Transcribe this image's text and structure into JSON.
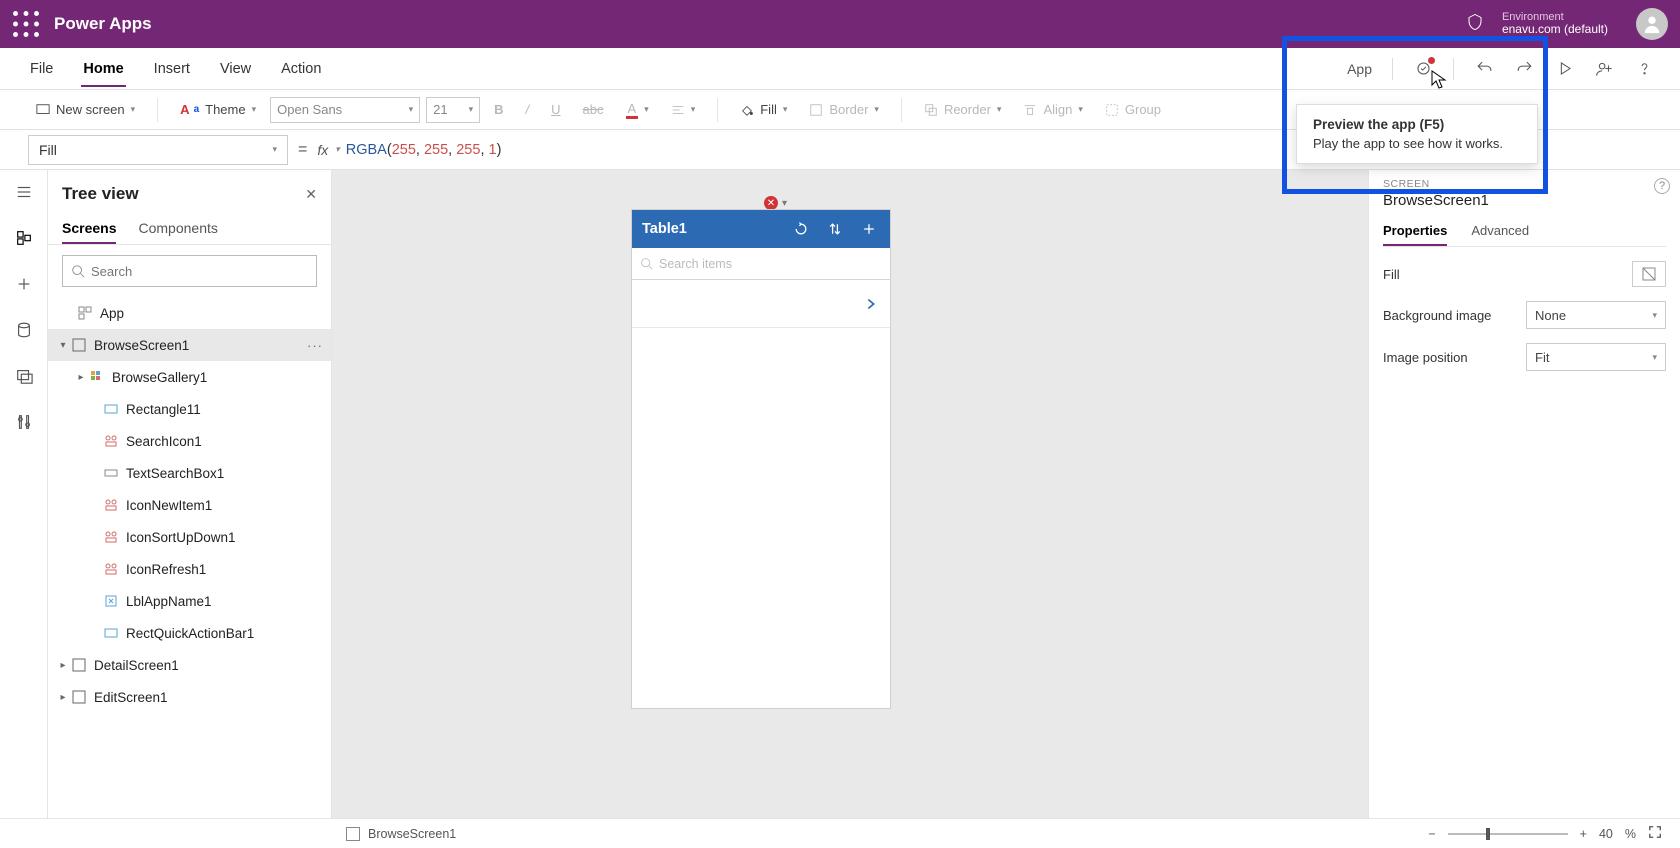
{
  "topbar": {
    "brand": "Power Apps",
    "env_label": "Environment",
    "env_value": "enavu.com (default)"
  },
  "menu": {
    "items": [
      "File",
      "Home",
      "Insert",
      "View",
      "Action"
    ],
    "active": 1,
    "app_label": "App"
  },
  "ribbon": {
    "new_screen": "New screen",
    "theme": "Theme",
    "font": "Open Sans",
    "size": "21",
    "fill": "Fill",
    "border": "Border",
    "reorder": "Reorder",
    "align": "Align",
    "group": "Group"
  },
  "formula": {
    "property": "Fill",
    "fn": "RGBA",
    "args": [
      "255",
      "255",
      "255",
      "1"
    ]
  },
  "tree": {
    "title": "Tree view",
    "tabs": [
      "Screens",
      "Components"
    ],
    "search_placeholder": "Search",
    "root": "App",
    "sel": "BrowseScreen1",
    "gallery": "BrowseGallery1",
    "items": [
      "Rectangle11",
      "SearchIcon1",
      "TextSearchBox1",
      "IconNewItem1",
      "IconSortUpDown1",
      "IconRefresh1",
      "LblAppName1",
      "RectQuickActionBar1"
    ],
    "screens": [
      "DetailScreen1",
      "EditScreen1"
    ]
  },
  "phone": {
    "title": "Table1",
    "search_ph": "Search items"
  },
  "props": {
    "section": "SCREEN",
    "name": "BrowseScreen1",
    "tabs": [
      "Properties",
      "Advanced"
    ],
    "fill_label": "Fill",
    "bg_label": "Background image",
    "bg_value": "None",
    "pos_label": "Image position",
    "pos_value": "Fit"
  },
  "status": {
    "screen": "BrowseScreen1",
    "zoom": "40",
    "zoom_unit": "%"
  },
  "tooltip": {
    "title": "Preview the app (F5)",
    "body": "Play the app to see how it works."
  }
}
